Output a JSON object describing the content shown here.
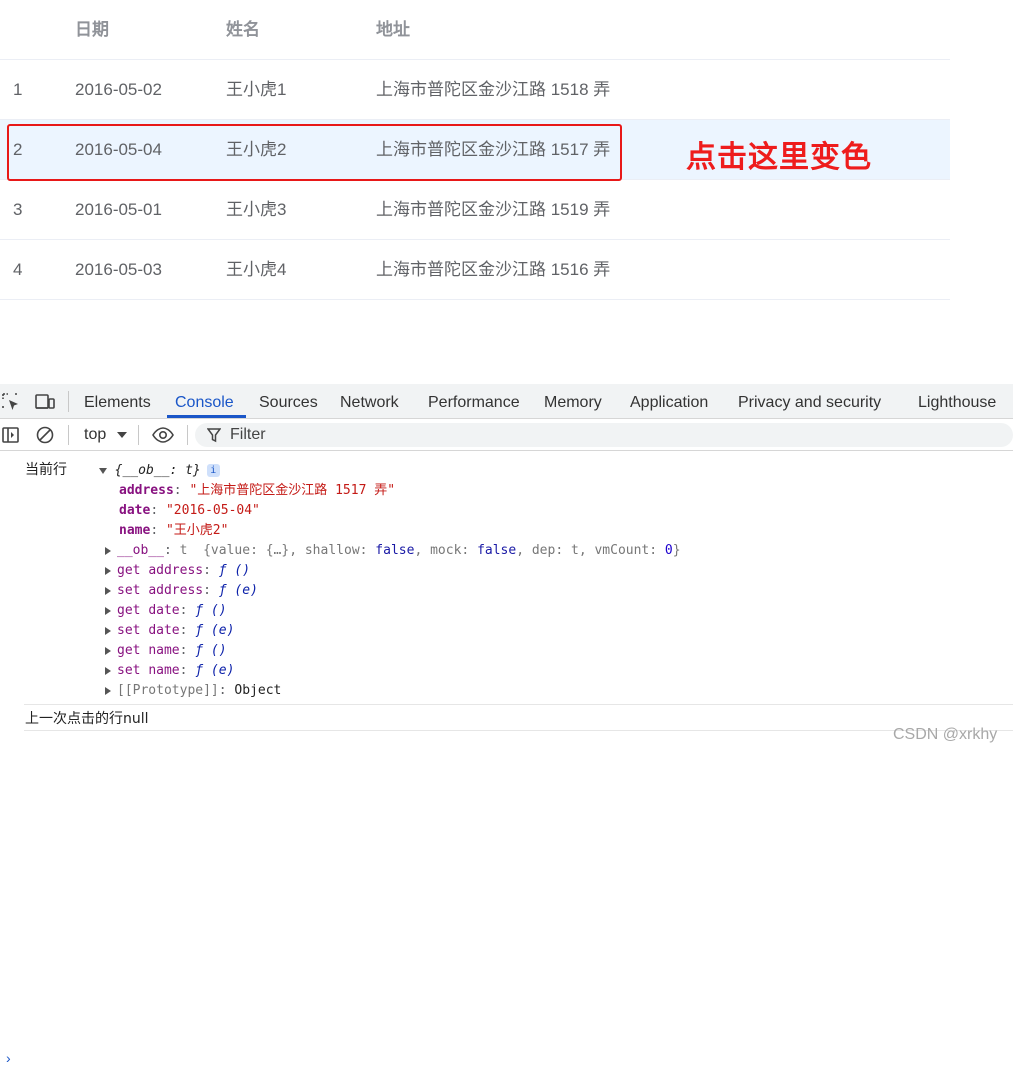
{
  "table": {
    "headers": [
      "",
      "日期",
      "姓名",
      "地址"
    ],
    "rows": [
      {
        "index": "1",
        "date": "2016-05-02",
        "name": "王小虎1",
        "address": "上海市普陀区金沙江路 1518 弄"
      },
      {
        "index": "2",
        "date": "2016-05-04",
        "name": "王小虎2",
        "address": "上海市普陀区金沙江路 1517 弄"
      },
      {
        "index": "3",
        "date": "2016-05-01",
        "name": "王小虎3",
        "address": "上海市普陀区金沙江路 1519 弄"
      },
      {
        "index": "4",
        "date": "2016-05-03",
        "name": "王小虎4",
        "address": "上海市普陀区金沙江路 1516 弄"
      }
    ],
    "active_row": 2
  },
  "annotation": "点击这里变色",
  "devtools": {
    "tabs": [
      "Elements",
      "Console",
      "Sources",
      "Network",
      "Performance",
      "Memory",
      "Application",
      "Privacy and security",
      "Lighthouse"
    ],
    "selected_tab": "Console",
    "context": "top",
    "filter_placeholder": "Filter"
  },
  "console": {
    "log1_label": "当前行",
    "obj_preview": "{__ob__: t}",
    "address_key": "address",
    "address_val": "\"上海市普陀区金沙江路 1517 弄\"",
    "date_key": "date",
    "date_val": "\"2016-05-04\"",
    "name_key": "name",
    "name_val": "\"王小虎2\"",
    "ob_key": "__ob__",
    "ob_type": "t",
    "ob_preview_a": "{value: {…}, shallow: ",
    "ob_false1": "false",
    "ob_preview_b": ", mock: ",
    "ob_false2": "false",
    "ob_preview_c": ", dep: t, vmCount: ",
    "ob_zero": "0",
    "ob_preview_d": "}",
    "accessors": [
      {
        "prefix": "get",
        "name": "address",
        "sig": "ƒ ()"
      },
      {
        "prefix": "set",
        "name": "address",
        "sig": "ƒ (e)"
      },
      {
        "prefix": "get",
        "name": "date",
        "sig": "ƒ ()"
      },
      {
        "prefix": "set",
        "name": "date",
        "sig": "ƒ (e)"
      },
      {
        "prefix": "get",
        "name": "name",
        "sig": "ƒ ()"
      },
      {
        "prefix": "set",
        "name": "name",
        "sig": "ƒ (e)"
      }
    ],
    "proto_key": "[[Prototype]]",
    "proto_val": "Object",
    "log2": "上一次点击的行null"
  },
  "watermark": "CSDN @xrkhy",
  "colors": {
    "accent": "#1a56c8",
    "highlight_red": "#e81818",
    "active_row_bg": "#ecf5ff"
  }
}
